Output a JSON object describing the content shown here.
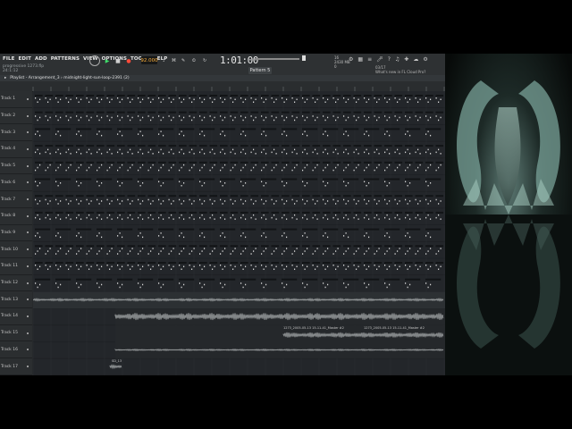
{
  "menu": [
    "FILE",
    "EDIT",
    "ADD",
    "PATTERNS",
    "VIEW",
    "OPTIONS",
    "TOOLS",
    "HELP"
  ],
  "project": {
    "name": "progressive 1273.flp",
    "info": "24:1:12"
  },
  "tempo": "92.000",
  "time_display": "1:01:00",
  "pattern": "Pattern 5",
  "cpu": {
    "cpu": "16",
    "ram": "2430 MB",
    "voices": "0"
  },
  "hint": {
    "version": "03/17",
    "text": "What's new in FL Cloud Pro?"
  },
  "playlist_title": "Playlist - Arrangement_3 › midnight-light-sun-loop-2391 (2)",
  "track_labels": [
    "Track 1",
    "Track 2",
    "Track 3",
    "Track 4",
    "Track 5",
    "Track 6",
    "Track 7",
    "Track 8",
    "Track 9",
    "Track 10",
    "Track 11",
    "Track 12",
    "Track 13",
    "Track 14",
    "Track 15",
    "Track 16",
    "Track 17"
  ],
  "audio_clips": [
    "1273_2005-05-13 15-11-41_Master #2",
    "1273_2005-05-13 15-11-41_Master #2",
    "SD_13"
  ]
}
